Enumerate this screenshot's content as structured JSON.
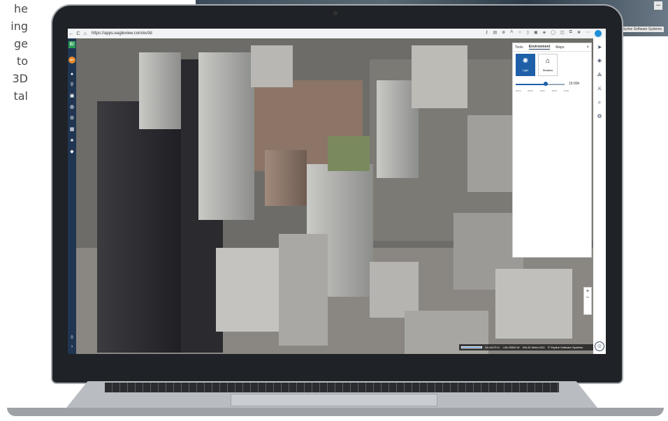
{
  "side_text": [
    "he",
    "ing",
    "ge",
    "to",
    "3D",
    "tal"
  ],
  "background": {
    "credit": "© Skyline Software Systems",
    "minus_label": "–"
  },
  "browser": {
    "url": "https://apps.eagleview.com/ev3d",
    "back": "←",
    "refresh": "C",
    "lock": "⌂"
  },
  "appbar": {
    "logo": "E/",
    "avatar": "MP",
    "icons": [
      "home-icon",
      "link-icon",
      "save-icon",
      "globe-icon",
      "settings-icon",
      "grid-icon",
      "star-icon",
      "bell-icon"
    ],
    "bottom_icons": [
      "help-icon",
      "expand-icon"
    ]
  },
  "panel": {
    "tabs": [
      "Tools",
      "Environment",
      "Maps"
    ],
    "active_tab": "Environment",
    "close": "×",
    "buttons": [
      {
        "label": "Light",
        "active": true
      },
      {
        "label": "Shadow",
        "active": false
      }
    ],
    "time_value": "15:00h",
    "ticks": [
      "00:00",
      "06:00",
      "12:00",
      "18:00",
      "24:00"
    ],
    "slider_level": 0.62
  },
  "zoom": {
    "plus": "+",
    "minus": "–"
  },
  "status": {
    "lat": "34.04475 N",
    "lon": "-118.25909 W",
    "altitude": "494.81 Meter AGL",
    "credit": "© Skyline Software Systems"
  },
  "colors": {
    "appbar": "#1f3552",
    "accent": "#1f5fa8",
    "logo": "#2c9b54",
    "avatar": "#e48a2c"
  }
}
